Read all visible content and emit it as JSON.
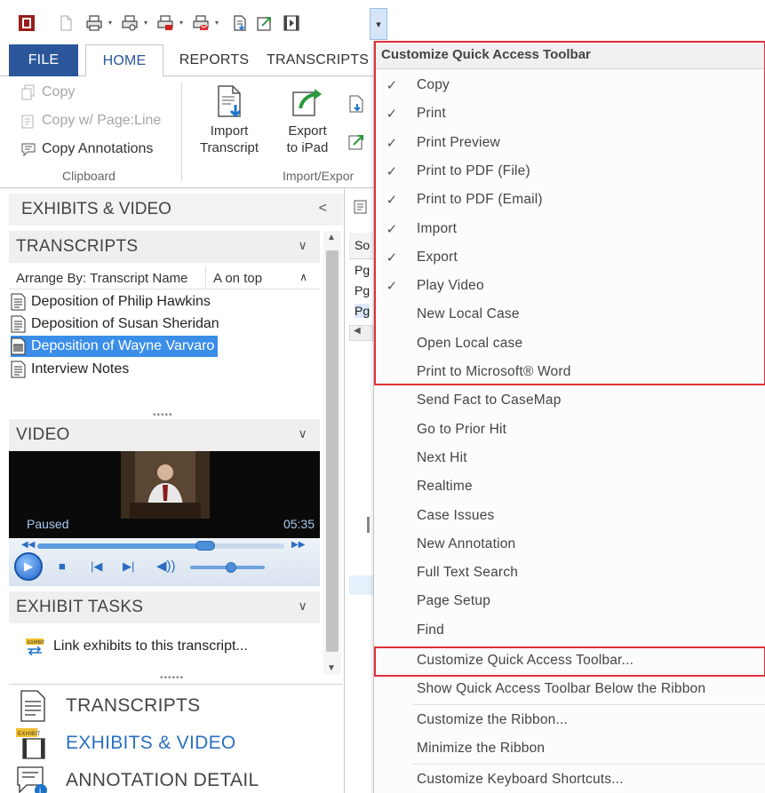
{
  "qat": {
    "icons": [
      "app-icon",
      "new-icon",
      "print-icon",
      "print-preview-icon",
      "print-to-pdf-file-icon",
      "print-to-pdf-email-icon",
      "import-icon",
      "export-icon",
      "play-video-icon"
    ],
    "dropdown_glyph": "▾"
  },
  "ribbon": {
    "tabs": [
      "FILE",
      "HOME",
      "REPORTS",
      "TRANSCRIPTS"
    ],
    "clipboard": {
      "copy": "Copy",
      "copy_page_line": "Copy w/ Page:Line",
      "copy_annotations": "Copy Annotations",
      "group_label": "Clipboard"
    },
    "import_export": {
      "import_line1": "Import",
      "import_line2": "Transcript",
      "export_line1": "Export",
      "export_line2": "to iPad",
      "group_label": "Import/Expor"
    }
  },
  "left_panel": {
    "title": "EXHIBITS & VIDEO",
    "collapse_glyph": "<",
    "transcripts_header": "TRANSCRIPTS",
    "arrange_by": "Arrange By: Transcript Name",
    "sort_order": "A on top",
    "transcripts": [
      "Deposition of Philip Hawkins",
      "Deposition of Susan Sheridan",
      "Deposition of Wayne Varvaro",
      "Interview Notes"
    ],
    "selected_index": 2,
    "video_header": "VIDEO",
    "video_status": "Paused",
    "video_time": "05:35",
    "video_progress": 0.68,
    "volume_level": 0.55,
    "exhibit_tasks_header": "EXHIBIT TASKS",
    "link_exhibits": "Link exhibits to this transcript...",
    "nav": [
      "TRANSCRIPTS",
      "EXHIBITS & VIDEO",
      "ANNOTATION DETAIL"
    ],
    "nav_active_index": 1
  },
  "middle": {
    "header": "So",
    "rows": [
      "Pg",
      "Pg",
      "Pg"
    ]
  },
  "dropdown": {
    "title": "Customize Quick Access Toolbar",
    "items": [
      {
        "label": "Copy",
        "checked": true
      },
      {
        "label": "Print",
        "checked": true
      },
      {
        "label": "Print Preview",
        "checked": true
      },
      {
        "label": "Print to PDF (File)",
        "checked": true
      },
      {
        "label": "Print to PDF (Email)",
        "checked": true
      },
      {
        "label": "Import",
        "checked": true
      },
      {
        "label": "Export",
        "checked": true
      },
      {
        "label": "Play Video",
        "checked": true
      },
      {
        "label": "New Local Case",
        "checked": false
      },
      {
        "label": "Open Local case",
        "checked": false
      },
      {
        "label": "Print to Microsoft® Word",
        "checked": false
      },
      {
        "label": "Send Fact to CaseMap",
        "checked": false
      },
      {
        "label": "Go to Prior Hit",
        "checked": false
      },
      {
        "label": "Next Hit",
        "checked": false
      },
      {
        "label": "Realtime",
        "checked": false
      },
      {
        "label": "Case Issues",
        "checked": false
      },
      {
        "label": "New Annotation",
        "checked": false
      },
      {
        "label": "Full Text Search",
        "checked": false
      },
      {
        "label": "Page Setup",
        "checked": false
      },
      {
        "label": "Find",
        "checked": false
      }
    ],
    "actions": [
      "Customize Quick Access Toolbar...",
      "Show Quick Access Toolbar Below the Ribbon",
      "Customize the Ribbon...",
      "Minimize the Ribbon",
      "Customize Keyboard Shortcuts..."
    ],
    "check_glyph": "✓",
    "highlight_color": "#e0303a"
  }
}
